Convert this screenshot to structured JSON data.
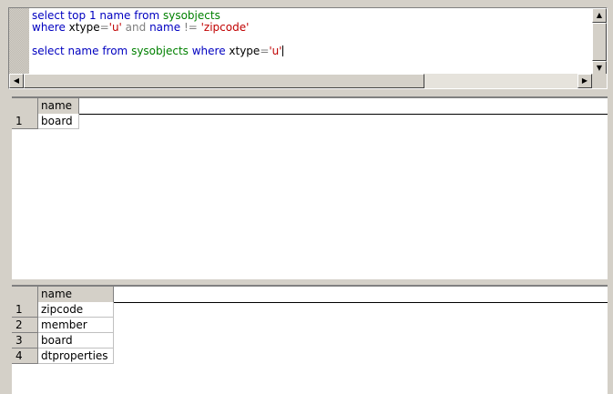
{
  "editor": {
    "lines": [
      {
        "parts": [
          {
            "t": "select top 1 name from ",
            "c": "kw"
          },
          {
            "t": "sysobjects",
            "c": "obj"
          }
        ]
      },
      {
        "parts": [
          {
            "t": "where ",
            "c": "kw"
          },
          {
            "t": "xtype",
            "c": ""
          },
          {
            "t": "=",
            "c": "op"
          },
          {
            "t": "'u'",
            "c": "str"
          },
          {
            "t": " and ",
            "c": "op"
          },
          {
            "t": "name ",
            "c": "kw"
          },
          {
            "t": "!= ",
            "c": "op"
          },
          {
            "t": "'zipcode'",
            "c": "str"
          }
        ]
      },
      {
        "parts": []
      },
      {
        "parts": [
          {
            "t": "select name from ",
            "c": "kw"
          },
          {
            "t": "sysobjects ",
            "c": "obj"
          },
          {
            "t": "where ",
            "c": "kw"
          },
          {
            "t": "xtype",
            "c": ""
          },
          {
            "t": "=",
            "c": "op"
          },
          {
            "t": "'u'",
            "c": "str"
          }
        ]
      }
    ],
    "scroll_up_icon": "up-arrow-icon",
    "scroll_down_icon": "down-arrow-icon",
    "scroll_left_icon": "left-arrow-icon",
    "scroll_right_icon": "right-arrow-icon"
  },
  "result1": {
    "columns": [
      "name"
    ],
    "rows": [
      {
        "num": "1",
        "values": [
          "board"
        ]
      }
    ]
  },
  "result2": {
    "columns": [
      "name"
    ],
    "rows": [
      {
        "num": "1",
        "values": [
          "zipcode"
        ]
      },
      {
        "num": "2",
        "values": [
          "member"
        ]
      },
      {
        "num": "3",
        "values": [
          "board"
        ]
      },
      {
        "num": "4",
        "values": [
          "dtproperties"
        ]
      }
    ]
  }
}
